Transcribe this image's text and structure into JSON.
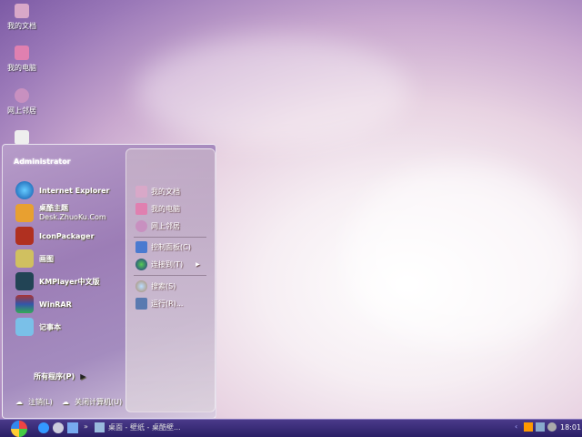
{
  "desktop": {
    "icons": [
      {
        "label": "我的文档"
      },
      {
        "label": "我的电脑"
      },
      {
        "label": "网上邻居"
      },
      {
        "label": ""
      }
    ]
  },
  "start_menu": {
    "user": "Administrator",
    "left_items": [
      {
        "label": "Internet Explorer",
        "icon": "ie-icon"
      },
      {
        "label": "桌酷主题",
        "sub": "Desk.ZhuoKu.Com",
        "icon": "theme-icon"
      },
      {
        "label": "IconPackager",
        "icon": "iconpackager-icon"
      },
      {
        "label": "画图",
        "icon": "paint-icon"
      },
      {
        "label": "KMPlayer中文版",
        "icon": "kmplayer-icon"
      },
      {
        "label": "WinRAR",
        "icon": "winrar-icon"
      },
      {
        "label": "记事本",
        "icon": "notepad-icon"
      }
    ],
    "all_programs": "所有程序(P)",
    "logoff": "注销(L)",
    "shutdown": "关闭计算机(U)",
    "right_items": [
      {
        "label": "我的文档"
      },
      {
        "label": "我的电脑"
      },
      {
        "label": "网上邻居"
      },
      {
        "label": "控制面板(C)"
      },
      {
        "label": "连接到(T)"
      },
      {
        "label": "搜索(S)"
      },
      {
        "label": "运行(R)..."
      }
    ]
  },
  "taskbar": {
    "window_label": "桌面 - 壁纸 - 桌酷壁...",
    "clock": "18:01"
  }
}
